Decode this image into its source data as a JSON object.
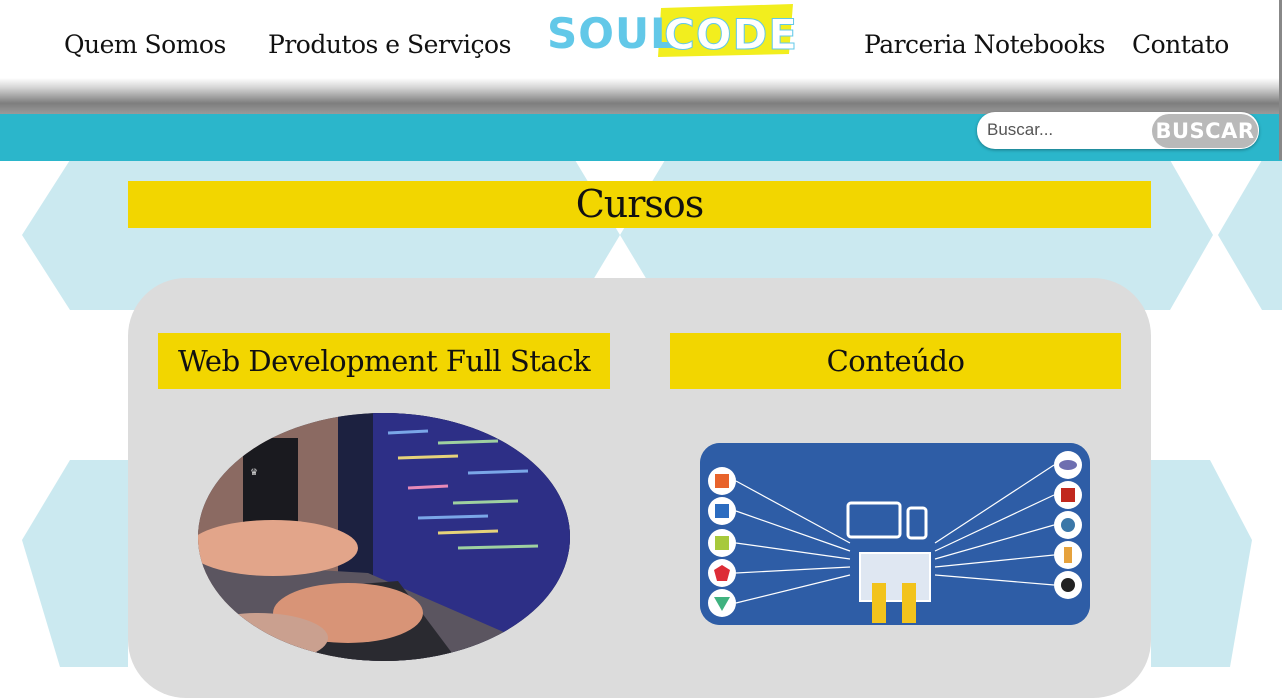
{
  "nav": {
    "quem_somos": "Quem Somos",
    "produtos": "Produtos e Serviços",
    "parceria": "Parceria Notebooks",
    "contato": "Contato"
  },
  "logo": {
    "part1": "SOUL",
    "part2": "CODE"
  },
  "search": {
    "placeholder": "Buscar...",
    "button_label": "BUSCAR"
  },
  "page": {
    "title": "Cursos"
  },
  "courses": [
    {
      "title": "Web Development Full Stack"
    },
    {
      "title": "Conteúdo"
    }
  ],
  "colors": {
    "accent_yellow": "#f2d600",
    "teal": "#2bb6cb",
    "logo_blue": "#62c8e8",
    "card_gray": "#dcdcdc"
  }
}
